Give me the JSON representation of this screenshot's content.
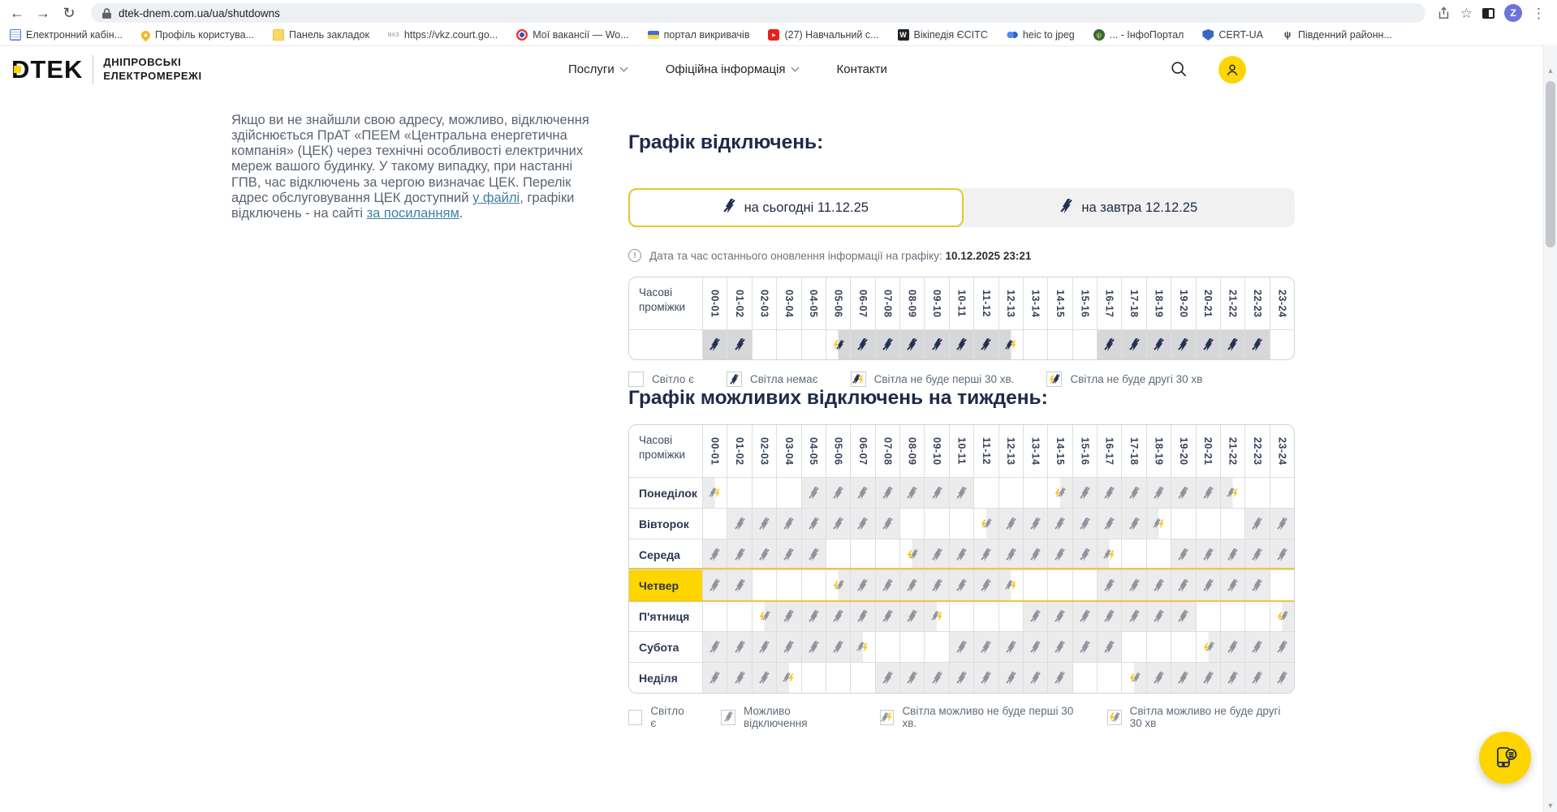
{
  "browser": {
    "url": "dtek-dnem.com.ua/ua/shutdowns",
    "avatar_letter": "Z",
    "bookmarks": [
      {
        "label": "Електронний кабін...",
        "icon": "document-icon"
      },
      {
        "label": "Профіль користува...",
        "icon": "pin-icon"
      },
      {
        "label": "Панель закладок",
        "icon": "note-icon"
      },
      {
        "label": "https://vkz.court.go...",
        "icon": "vkz-favicon"
      },
      {
        "label": "Мої вакансії — Wo...",
        "icon": "target-icon"
      },
      {
        "label": "портал викривачів",
        "icon": "ukraine-flag-icon"
      },
      {
        "label": "(27) Навчальний с...",
        "icon": "youtube-icon"
      },
      {
        "label": "Вікіпедія ЄСІТС",
        "icon": "wikipedia-icon"
      },
      {
        "label": "heic to jpeg",
        "icon": "butterfly-icon"
      },
      {
        "label": "... - ІнфоПортал",
        "icon": "infoportal-icon"
      },
      {
        "label": "CERT-UA",
        "icon": "shield-icon"
      },
      {
        "label": "Південний районн...",
        "icon": "trident-icon"
      }
    ]
  },
  "site_header": {
    "brand": "DTEK",
    "brand_line1": "ДНІПРОВСЬКІ",
    "brand_line2": "ЕЛЕКТРОМЕРЕЖІ",
    "nav_items": [
      {
        "label": "Послуги",
        "chevron": true
      },
      {
        "label": "Офіційна інформація",
        "chevron": true
      },
      {
        "label": "Контакти",
        "chevron": false
      }
    ]
  },
  "intro": {
    "text_before_link1": "Якщо ви не знайшли свою адресу, можливо, відключення здійснюється ПрАТ «ПЕЕМ «Центральна енергетична компанія» (ЦЕК) через технічні особливості електричних мереж вашого будинку. У такому випадку, при настанні ГПВ, час відключень за чергою визначає ЦЕК. Перелік адрес обслуговування ЦЕК доступний ",
    "link1": "у файлі",
    "text_between": ", графіки відключень - на сайті ",
    "link2": "за посиланням",
    "text_after": "."
  },
  "main": {
    "heading_today": "Графік відключень:",
    "heading_week": "Графік можливих відключень на тиждень:",
    "tabs": [
      {
        "label": "на сьогодні 11.12.25",
        "active": true
      },
      {
        "label": "на завтра 12.12.25",
        "active": false
      }
    ],
    "update_label": "Дата та час останнього оновлення інформації на графіку:",
    "update_value": "10.12.2025 23:21",
    "time_col_header": "Часові проміжки",
    "legend_today": [
      {
        "type": "on",
        "label": "Світло є"
      },
      {
        "type": "off",
        "label": "Світла немає"
      },
      {
        "type": "first30",
        "label": "Світла не буде перші 30 хв."
      },
      {
        "type": "second30",
        "label": "Світла не буде другі 30 хв"
      }
    ],
    "legend_week": [
      {
        "type": "on",
        "label": "Світло є"
      },
      {
        "type": "off",
        "label": "Можливо відключення"
      },
      {
        "type": "first30",
        "label": "Світла можливо не буде перші 30 хв."
      },
      {
        "type": "second30",
        "label": "Світла можливо не буде другі 30 хв"
      }
    ]
  },
  "chart_data": {
    "type": "heatmap",
    "time_slots": [
      "00-01",
      "01-02",
      "02-03",
      "03-04",
      "04-05",
      "05-06",
      "06-07",
      "07-08",
      "08-09",
      "09-10",
      "10-11",
      "11-12",
      "12-13",
      "13-14",
      "14-15",
      "15-16",
      "16-17",
      "17-18",
      "18-19",
      "19-20",
      "20-21",
      "21-22",
      "22-23",
      "23-24"
    ],
    "code_meanings": {
      "0": "світло є",
      "1": "відключення (світла немає)",
      "F": "світла не буде перші 30 хв",
      "S": "світла не буде другі 30 хв"
    },
    "today_date": "11.12.25",
    "today_schedule": [
      1,
      1,
      0,
      0,
      0,
      "S",
      1,
      1,
      1,
      1,
      1,
      1,
      "F",
      0,
      0,
      0,
      1,
      1,
      1,
      1,
      1,
      1,
      1,
      0
    ],
    "week_schedule": [
      {
        "day": "Понеділок",
        "values": [
          "F",
          0,
          0,
          0,
          1,
          1,
          1,
          1,
          1,
          1,
          1,
          0,
          0,
          0,
          "S",
          1,
          1,
          1,
          1,
          1,
          1,
          "F",
          0,
          0
        ]
      },
      {
        "day": "Вівторок",
        "values": [
          0,
          1,
          1,
          1,
          1,
          1,
          1,
          1,
          0,
          0,
          0,
          "S",
          1,
          1,
          1,
          1,
          1,
          1,
          "F",
          0,
          0,
          0,
          1,
          1
        ]
      },
      {
        "day": "Середа",
        "values": [
          1,
          1,
          1,
          1,
          1,
          0,
          0,
          0,
          "S",
          1,
          1,
          1,
          1,
          1,
          1,
          1,
          "F",
          0,
          0,
          1,
          1,
          1,
          1,
          1
        ]
      },
      {
        "day": "Четвер",
        "values": [
          1,
          1,
          0,
          0,
          0,
          "S",
          1,
          1,
          1,
          1,
          1,
          1,
          "F",
          0,
          0,
          0,
          1,
          1,
          1,
          1,
          1,
          1,
          1,
          0
        ]
      },
      {
        "day": "П'ятниця",
        "values": [
          0,
          0,
          "S",
          1,
          1,
          1,
          1,
          1,
          1,
          "F",
          0,
          0,
          0,
          1,
          1,
          1,
          1,
          1,
          1,
          1,
          0,
          0,
          0,
          "S"
        ]
      },
      {
        "day": "Субота",
        "values": [
          1,
          1,
          1,
          1,
          1,
          1,
          "F",
          0,
          0,
          0,
          1,
          1,
          1,
          1,
          1,
          1,
          1,
          0,
          0,
          0,
          "S",
          1,
          1,
          1
        ]
      },
      {
        "day": "Неділя",
        "values": [
          1,
          1,
          1,
          "F",
          0,
          0,
          0,
          1,
          1,
          1,
          1,
          1,
          1,
          1,
          1,
          0,
          0,
          "S",
          1,
          1,
          1,
          1,
          1,
          1
        ]
      }
    ],
    "highlighted_day": "Четвер"
  },
  "colors": {
    "accent_yellow": "#FFD500",
    "navy": "#1F2B47",
    "today_bolt": "#223052",
    "week_bolt": "#8E949E",
    "today_cell": "#D6D7D8",
    "week_cell": "#ECECED",
    "bolt_yellow": "#FFC520",
    "link": "#3F7FA0"
  }
}
